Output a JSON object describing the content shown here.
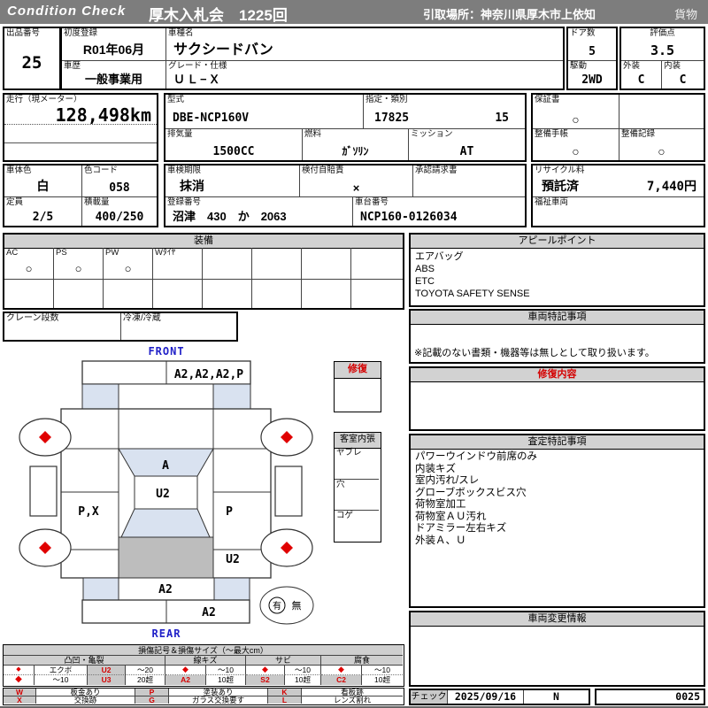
{
  "header": {
    "brand": "Condition  Check",
    "title": "厚木入札会　1225回",
    "pickup": "引取場所：神奈川県厚木市上依知",
    "category": "貨物"
  },
  "info": {
    "lot_label": "出品番号",
    "lot_value": "25",
    "first_reg_label": "初度登録",
    "first_reg_value": "R01年06月",
    "model_name_label": "車種名",
    "model_name_value": "サクシードバン",
    "history_label": "車歴",
    "history_value": "一般事業用",
    "grade_label": "グレード・仕様",
    "grade_value": "ＵＬ−Ｘ",
    "doors_label": "ドア数",
    "doors_value": "5",
    "drive_label": "駆動",
    "drive_value": "2WD",
    "score_label": "評価点",
    "score_value": "3.5",
    "exterior_label": "外装",
    "exterior_value": "C",
    "interior_label": "内装",
    "interior_value": "C",
    "mileage_label": "走行（現メーター）",
    "mileage_value": "128,498km",
    "model_code_label": "型式",
    "model_code_value": "DBE-NCP160V",
    "class_label": "指定・類別",
    "class_value1": "17825",
    "class_value2": "15",
    "displacement_label": "排気量",
    "displacement_value": "1500CC",
    "fuel_label": "燃料",
    "fuel_value": "ｶﾞｿﾘﾝ",
    "mission_label": "ミッション",
    "mission_value": "AT",
    "warranty_label": "保証書",
    "warranty_value": "○",
    "book_label": "整備手帳",
    "book_value": "○",
    "record_label": "整備記録",
    "record_value": "○",
    "color_label": "車体色",
    "color_value": "白",
    "color_code_label": "色コード",
    "color_code_value": "058",
    "capacity_label": "定員",
    "capacity_value": "2/5",
    "load_label": "積載量",
    "load_value": "400/250",
    "inspection_label": "車検期限",
    "inspection_value": "抹消",
    "insurance_label": "検付自賠責",
    "insurance_value": "×",
    "approval_label": "承認請求書",
    "reg_number_label": "登録番号",
    "reg_number_value": "沼津　430　か　2063",
    "chassis_label": "車台番号",
    "chassis_value": "NCP160-0126034",
    "recycle_label": "リサイクル料",
    "recycle_status": "預託済",
    "recycle_fee": "7,440円",
    "welfare_label": "福祉車両"
  },
  "equipment": {
    "title": "装備",
    "cells": [
      {
        "label": "AC",
        "mark": "○"
      },
      {
        "label": "PS",
        "mark": "○"
      },
      {
        "label": "PW",
        "mark": "○"
      },
      {
        "label": "Wﾀｲﾔ",
        "mark": ""
      },
      {
        "label": "",
        "mark": ""
      },
      {
        "label": "",
        "mark": ""
      },
      {
        "label": "",
        "mark": ""
      },
      {
        "label": "",
        "mark": ""
      }
    ],
    "crane_label": "クレーン段数",
    "freezer_label": "冷凍/冷蔵"
  },
  "diagram": {
    "front_label": "FRONT",
    "rear_label": "REAR",
    "zones": {
      "front_bumper_right": "A2,A2,A2,P",
      "windshield": "A",
      "roof": "U2",
      "door_left": "P,X",
      "door_right": "P",
      "quarter_right": "U2",
      "rear_panel": "A2",
      "rear_gate": "A2"
    },
    "repair_title": "修復",
    "cabin_title": "客室内張",
    "cabin_rows": [
      "ヤブレ",
      "穴",
      "コゲ"
    ],
    "spare_yes": "有",
    "spare_no": "無"
  },
  "right": {
    "appeal": {
      "title": "アピールポイント",
      "lines": [
        "エアバッグ",
        "ABS",
        "ETC",
        "TOYOTA SAFETY SENSE"
      ]
    },
    "notes": {
      "title": "車両特記事項",
      "footnote": "※記載のない書類・機器等は無しとして取り扱います。"
    },
    "repair": {
      "title": "修復内容"
    },
    "assessment": {
      "title": "査定特記事項",
      "lines": [
        "パワーウインドウ前席のみ",
        "内装キズ",
        "室内汚れ/スレ",
        "グローブボックスビス穴",
        "荷物室加工",
        "荷物室ＡＵ汚れ",
        "ドアミラー左右キズ",
        "外装Ａ、Ｕ"
      ]
    },
    "change_info": {
      "title": "車両変更情報"
    },
    "check": {
      "label": "チェック",
      "date": "2025/09/16",
      "inspector": "N",
      "number": "0025"
    }
  },
  "legend": {
    "title": "損傷記号＆損傷サイズ（〜最大cm）",
    "cats": [
      "凸凹・亀裂",
      "線キズ",
      "サビ",
      "腐食"
    ],
    "row1": [
      "◆",
      "エクボ",
      "U2",
      "〜20",
      "◆",
      "〜10",
      "◆",
      "〜10",
      "◆",
      "〜10"
    ],
    "row2": [
      "◆",
      "〜10",
      "U3",
      "20超",
      "A2",
      "10超",
      "S2",
      "10超",
      "C2",
      "10超"
    ],
    "codes1": [
      {
        "c": "W",
        "d": "板金あり"
      },
      {
        "c": "P",
        "d": "塗装あり"
      },
      {
        "c": "K",
        "d": "看板跡"
      }
    ],
    "codes2": [
      {
        "c": "X",
        "d": "交換跡"
      },
      {
        "c": "G",
        "d": "ガラス交換要す"
      },
      {
        "c": "L",
        "d": "レンズ割れ"
      }
    ]
  },
  "colors": {
    "header_bar": "#7d7d7d",
    "section_header": "#d2d2d2",
    "accent_red": "#d40000",
    "label_blue": "#2121c8",
    "glass_blue": "#d9e2f0",
    "cargo_gray": "#bdbdbd"
  }
}
